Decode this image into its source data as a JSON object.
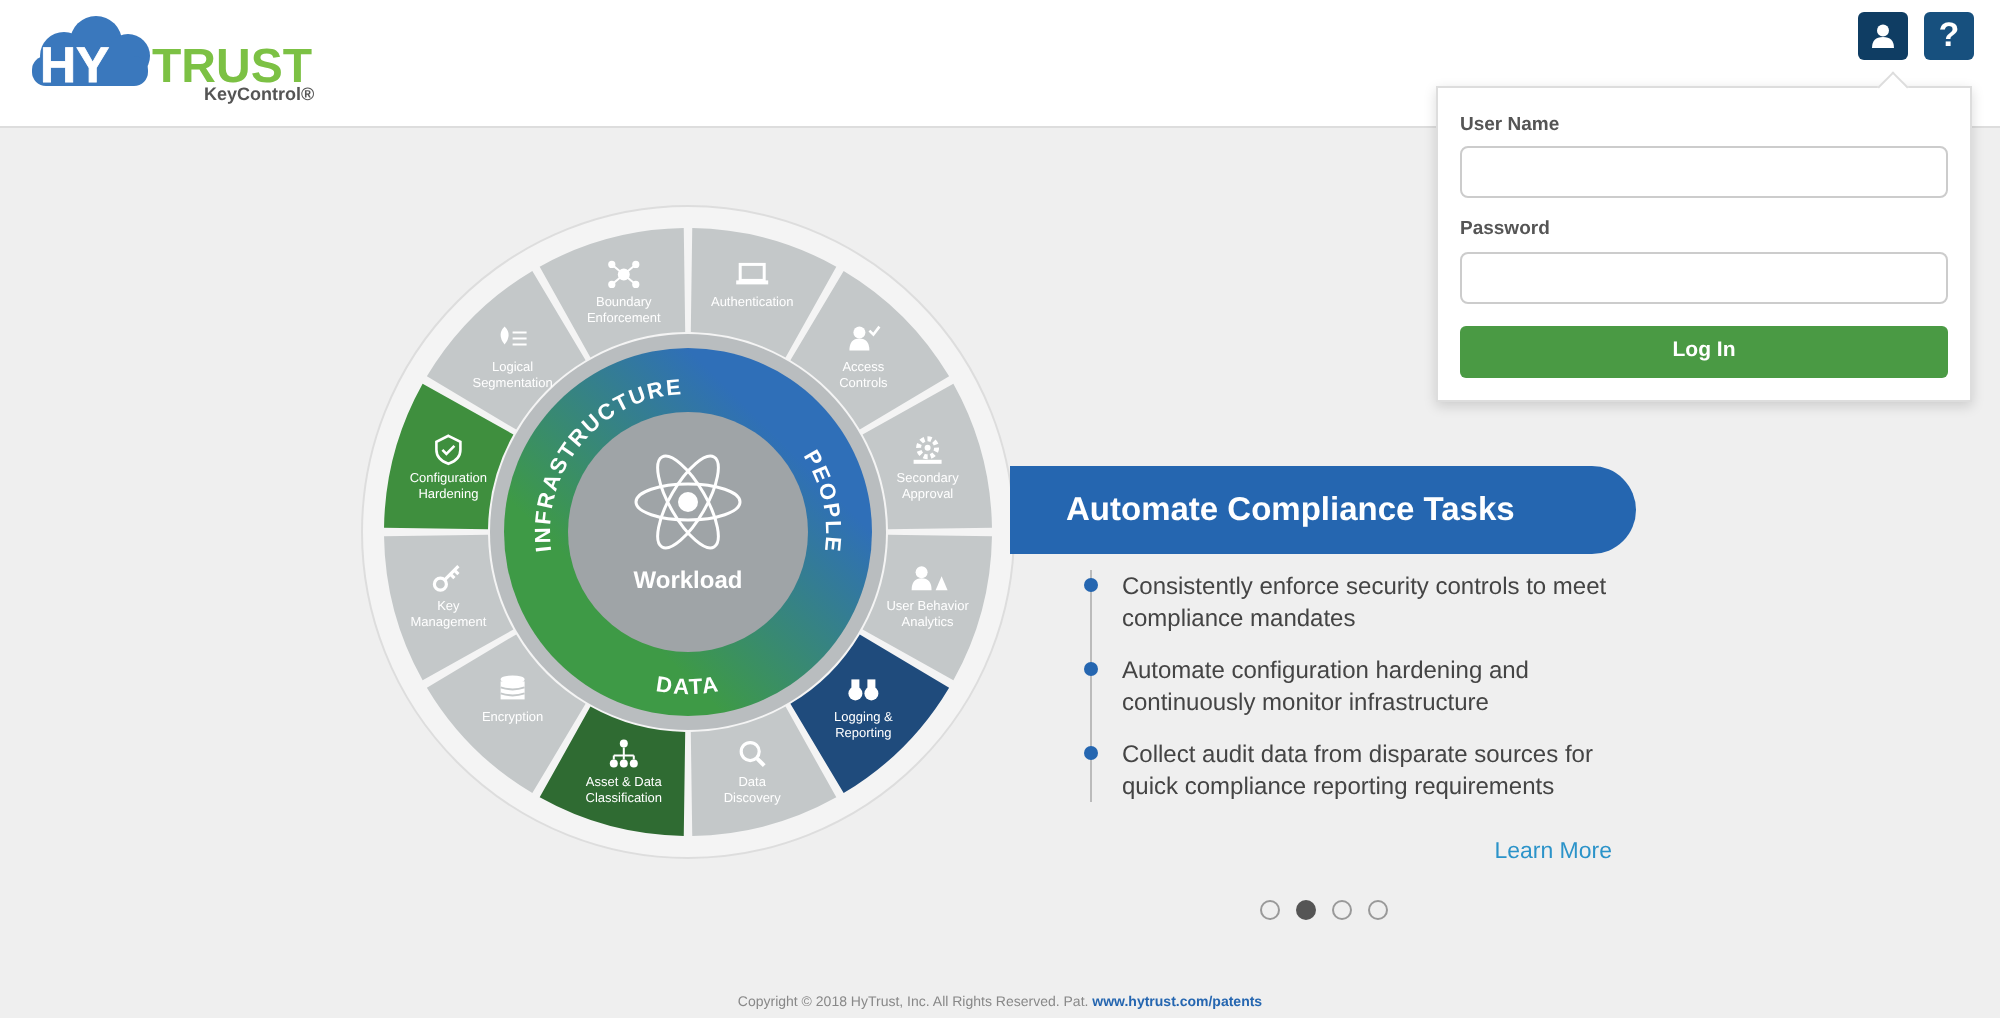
{
  "header": {
    "logo": {
      "brand_part1": "HY",
      "brand_part2": "TRUST",
      "product": "KeyControl®"
    },
    "user_button": {
      "expanded": true
    },
    "help_button": {
      "label": "?"
    }
  },
  "login": {
    "fields": [
      {
        "label": "User Name"
      },
      {
        "label": "Password"
      }
    ],
    "button": "Log In"
  },
  "wheel": {
    "center": "Workload",
    "ring": [
      "INFRASTRUCTURE",
      "PEOPLE",
      "DATA"
    ],
    "segments": [
      {
        "label": "Boundary Enforcement",
        "color": "#c4c8c9"
      },
      {
        "label": "Authentication",
        "color": "#c4c8c9"
      },
      {
        "label": "Logical Segmentation",
        "color": "#c4c8c9"
      },
      {
        "label": "Access Controls",
        "color": "#c4c8c9"
      },
      {
        "label": "Configuration Hardening",
        "color": "#3f8f3e"
      },
      {
        "label": "Secondary Approval",
        "color": "#c4c8c9"
      },
      {
        "label": "Key Management",
        "color": "#c4c8c9"
      },
      {
        "label": "User Behavior Analytics",
        "color": "#c4c8c9"
      },
      {
        "label": "Encryption",
        "color": "#c4c8c9"
      },
      {
        "label": "Logging & Reporting",
        "color": "#1f4b7c"
      },
      {
        "label": "Asset & Data Classification",
        "color": "#2f6b32"
      },
      {
        "label": "Data Discovery",
        "color": "#c4c8c9"
      }
    ]
  },
  "carousel": {
    "title": "Automate Compliance Tasks",
    "bullets": [
      "Consistently enforce security controls to meet compliance mandates",
      "Automate configuration hardening and continuously monitor infrastructure",
      "Collect audit data from disparate sources for quick compliance reporting requirements"
    ],
    "link": "Learn More",
    "dots": [
      {
        "selected": false
      },
      {
        "selected": true
      },
      {
        "selected": false
      },
      {
        "selected": false
      }
    ]
  },
  "footer": {
    "text": "Copyright © 2018 HyTrust, Inc. All Rights Reserved. Pat.",
    "link": "www.hytrust.com/patents"
  }
}
